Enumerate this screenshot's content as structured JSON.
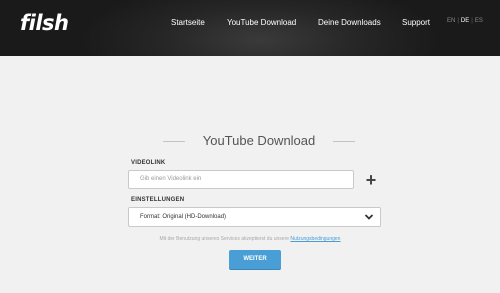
{
  "header": {
    "logo": "filsh",
    "nav": [
      "Startseite",
      "YouTube Download",
      "Deine Downloads",
      "Support"
    ],
    "languages": {
      "en": "EN",
      "de": "DE",
      "es": "ES",
      "active": "DE"
    }
  },
  "form": {
    "title": "YouTube Download",
    "videolink_label": "VIDEOLINK",
    "videolink_placeholder": "Gib einen Videolink ein",
    "settings_label": "EINSTELLUNGEN",
    "format_label": "Format:",
    "format_value": "Original (HD-Download)",
    "terms_text": "Mit der Benutzung unseres Services akzeptierst du unsere",
    "terms_link": "Nutzungsbedingungen",
    "submit_label": "WEITER"
  },
  "colors": {
    "header_bg": "#1e1e1e",
    "accent": "#4a9ed6",
    "page_bg": "#f1f1f1"
  }
}
